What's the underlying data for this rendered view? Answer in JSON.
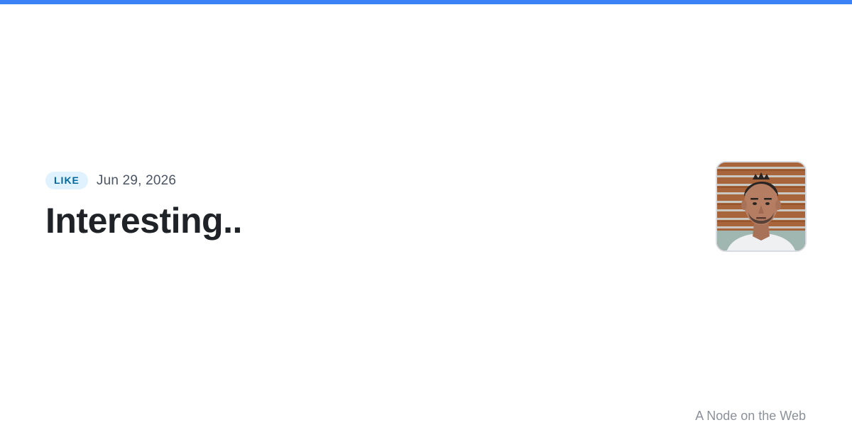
{
  "post": {
    "type_badge": "LIKE",
    "date": "Jun 29, 2026",
    "title": "Interesting.."
  },
  "author": {
    "avatar_alt": "author-avatar"
  },
  "site": {
    "name": "A Node on the Web"
  },
  "colors": {
    "accent": "#3b82f6",
    "badge_bg": "#e0f2fe",
    "badge_text": "#0369a1",
    "title_text": "#1f2328",
    "muted_text": "#8b9199"
  }
}
